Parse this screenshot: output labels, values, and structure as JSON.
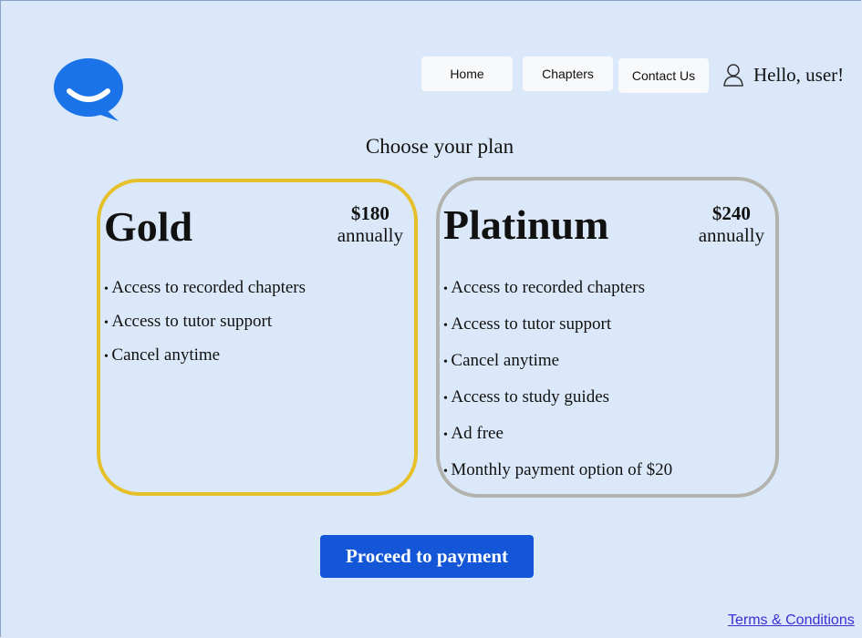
{
  "header": {
    "logo_icon": "chat-bubble-smile-icon",
    "nav": {
      "home": "Home",
      "chapters": "Chapters",
      "contact": "Contact Us"
    },
    "user_icon": "user-icon",
    "greeting": "Hello, user!"
  },
  "main": {
    "heading": "Choose your plan",
    "plans": [
      {
        "name": "Gold",
        "price": "$180",
        "period": "annually",
        "border_color": "#e6c02a",
        "features": [
          "Access to recorded chapters",
          "Access to tutor support",
          "Cancel anytime"
        ]
      },
      {
        "name": "Platinum",
        "price": "$240",
        "period": "annually",
        "border_color": "#b2b3ad",
        "features": [
          "Access to recorded chapters",
          "Access to tutor support",
          "Cancel anytime",
          "Access to study guides",
          "Ad free",
          "Monthly payment option of $20"
        ]
      }
    ],
    "proceed_label": "Proceed to payment"
  },
  "footer": {
    "terms_label": "Terms & Conditions"
  },
  "colors": {
    "background": "#dbe8f9",
    "logo": "#1a73e8",
    "primary_button": "#1357d8",
    "link": "#3b2fd6"
  }
}
